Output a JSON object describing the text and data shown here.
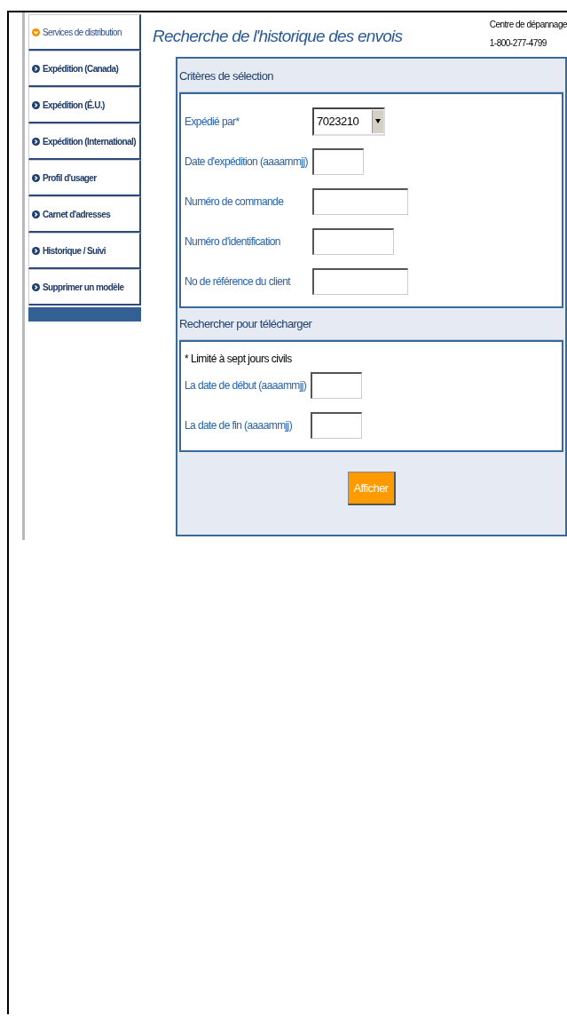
{
  "sidebar": {
    "items": [
      {
        "label": "Services de distribution",
        "selected": true
      },
      {
        "label": "Expédition (Canada)",
        "selected": false
      },
      {
        "label": "Expédition (É.U.)",
        "selected": false
      },
      {
        "label": "Expédition (International)",
        "selected": false
      },
      {
        "label": "Profil d'usager",
        "selected": false
      },
      {
        "label": "Carnet d'adresses",
        "selected": false
      },
      {
        "label": "Historique / Suivi",
        "selected": false
      },
      {
        "label": "Supprimer un modèle",
        "selected": false
      }
    ]
  },
  "page_title": "Recherche de l'historique des envois",
  "help": {
    "label": "Centre de dépannage",
    "phone": "1-800-277-4799"
  },
  "sections": [
    {
      "title": "Critères de sélection",
      "fields": [
        {
          "kind": "select",
          "label": "Expédié par*",
          "value": "7023210"
        },
        {
          "kind": "text",
          "label": "Date d'expédition (aaaammjj)"
        },
        {
          "kind": "text",
          "label": "Numéro de commande"
        },
        {
          "kind": "text",
          "label": "Numéro d'identification"
        },
        {
          "kind": "text",
          "label": "No de référence du client"
        }
      ]
    },
    {
      "title": "Rechercher pour télécharger",
      "note": "* Limité à sept jours civils",
      "fields": [
        {
          "kind": "text",
          "label": "La date de début (aaaammjj)"
        },
        {
          "kind": "text",
          "label": "La date de fin (aaaammjj)"
        }
      ]
    }
  ],
  "button": "Afficher"
}
